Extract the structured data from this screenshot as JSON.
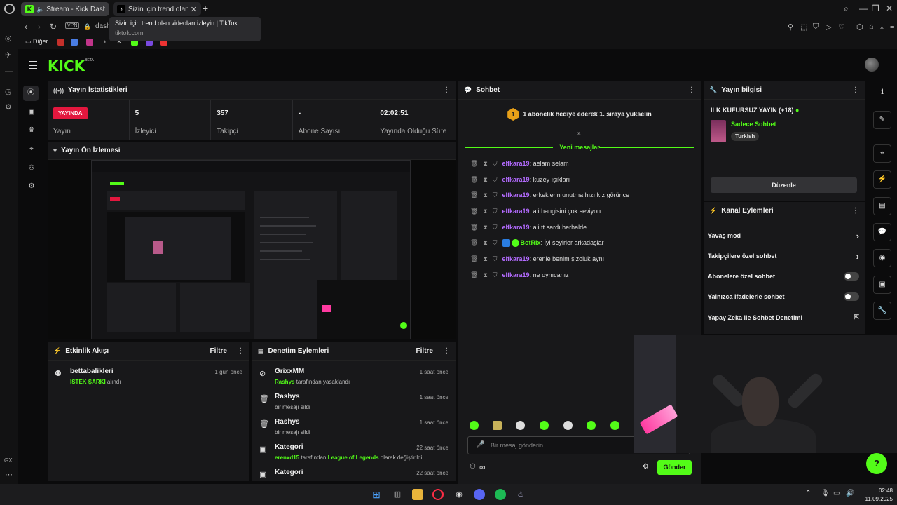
{
  "browser": {
    "tabs": [
      {
        "label": "Stream - Kick Dashbo"
      },
      {
        "label": "Sizin için trend olan v"
      }
    ],
    "tooltip": {
      "title": "Sizin için trend olan videoları izleyin | TikTok",
      "domain": "tiktok.com"
    },
    "vpn_label": "VPN",
    "url": "dashb",
    "bookmarks_folder": "Diğer"
  },
  "kick": {
    "logo": "KICK",
    "beta": "BETA",
    "stats_panel": {
      "title": "Yayın İstatistikleri",
      "live_badge": "YAYINDA",
      "live_label": "Yayın",
      "viewers_value": "5",
      "viewers_label": "İzleyici",
      "followers_value": "357",
      "followers_label": "Takipçi",
      "subs_value": "-",
      "subs_label": "Abone Sayısı",
      "uptime_value": "02:02:51",
      "uptime_label": "Yayında Olduğu Süre"
    },
    "preview_panel": {
      "title": "Yayın Ön İzlemesi"
    },
    "activity_panel": {
      "title": "Etkinlik Akışı",
      "filter": "Filtre",
      "items": [
        {
          "name": "bettabalikleri",
          "highlight": "İSTEK ŞARKI",
          "text": "alındı",
          "time": "1 gün önce"
        }
      ]
    },
    "moderation_panel": {
      "title": "Denetim Eylemleri",
      "filter": "Filtre",
      "items": [
        {
          "name": "GrixxMM",
          "highlight": "Rashys",
          "text": "tarafından yasaklandı",
          "time": "1 saat önce"
        },
        {
          "name": "Rashys",
          "text": "bir mesajı sildi",
          "time": "1 saat önce"
        },
        {
          "name": "Rashys",
          "text": "bir mesajı sildi",
          "time": "1 saat önce"
        },
        {
          "name": "Kategori",
          "highlight": "erenxd15",
          "text": "tarafından",
          "highlight2": "League of Legends",
          "text2": "olarak değiştirildi",
          "time": "22 saat önce"
        },
        {
          "name": "Kategori",
          "time": "22 saat önce"
        }
      ]
    },
    "chat_panel": {
      "title": "Sohbet",
      "gift_badge": "1",
      "gift_notice": "1 abonelik hediye ederek 1. sıraya yükselin",
      "new_messages": "Yeni mesajlar",
      "messages": [
        {
          "user": "elfkara19",
          "text": "aelam selam"
        },
        {
          "user": "elfkara19",
          "text": "kuzey ışıkları"
        },
        {
          "user": "elfkara19",
          "text": "erkeklerin unutma hızı kız görünce"
        },
        {
          "user": "elfkara19",
          "text": "ali hangisini çok seviyon"
        },
        {
          "user": "elfkara19",
          "text": "ali tt sardı herhalde"
        },
        {
          "user": "BotRix",
          "text": "İyi seyirler arkadaşlar"
        },
        {
          "user": "elfkara19",
          "text": "erenle benim şizoluk aynı"
        },
        {
          "user": "elfkara19",
          "text": "ne oynıcanız"
        }
      ],
      "input_placeholder": "Bir mesaj gönderin",
      "send": "Gönder"
    },
    "stream_info_panel": {
      "title": "Yayın bilgisi",
      "stream_title": "İLK KÜFÜRSÜZ YAYIN (+18)",
      "category": "Sadece Sohbet",
      "tag": "Turkish",
      "edit": "Düzenle"
    },
    "channel_actions_panel": {
      "title": "Kanal Eylemleri",
      "items": [
        {
          "label": "Yavaş mod",
          "control": "arrow"
        },
        {
          "label": "Takipçilere özel sohbet",
          "control": "arrow"
        },
        {
          "label": "Abonelere özel sohbet",
          "control": "toggle",
          "on": false
        },
        {
          "label": "Yalnızca ifadelerle sohbet",
          "control": "toggle",
          "on": false
        },
        {
          "label": "Yapay Zeka ile Sohbet Denetimi",
          "control": "external"
        }
      ]
    }
  },
  "taskbar": {
    "time": "02:48",
    "date": "11.09.2025"
  },
  "colors": {
    "kick_green": "#53fc18",
    "live_red": "#e3173e",
    "username_purple": "#b36bff",
    "panel_bg": "#18181a",
    "page_bg": "#0b0b0c"
  }
}
